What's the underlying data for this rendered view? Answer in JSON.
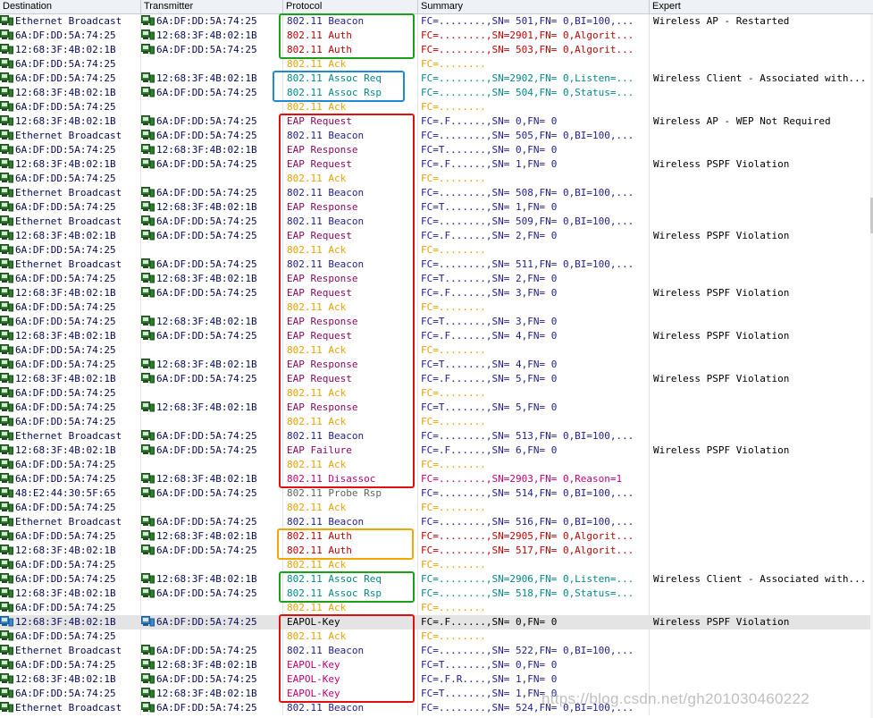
{
  "columns": [
    "Destination",
    "Transmitter",
    "Protocol",
    "Summary",
    "Expert"
  ],
  "colors": {
    "beacon": "#1e1e8c",
    "auth": "#c00000",
    "ack": "#e8a000",
    "assoc": "#008888",
    "eap": "#8a0a60",
    "eapol": "#000000",
    "probe": "#606060",
    "disassoc": "#c0007a",
    "summary_default": "#1e1e8c",
    "box_green": "#1ca01c",
    "box_blue": "#1e8ad6",
    "box_red": "#e01010",
    "box_orange": "#f0a800"
  },
  "rows": [
    {
      "dst": "Ethernet Broadcast",
      "tx": "6A:DF:DD:5A:74:25",
      "proto": "802.11 Beacon",
      "pc": "beacon",
      "sum": "FC=........,SN= 501,FN= 0,BI=100,...",
      "sc": "beacon",
      "exp": "Wireless AP - Restarted"
    },
    {
      "dst": "6A:DF:DD:5A:74:25",
      "tx": "12:68:3F:4B:02:1B",
      "proto": "802.11 Auth",
      "pc": "auth",
      "sum": "FC=........,SN=2901,FN= 0,Algorit...",
      "sc": "auth",
      "exp": ""
    },
    {
      "dst": "12:68:3F:4B:02:1B",
      "tx": "6A:DF:DD:5A:74:25",
      "proto": "802.11 Auth",
      "pc": "auth",
      "sum": "FC=........,SN= 503,FN= 0,Algorit...",
      "sc": "auth",
      "exp": ""
    },
    {
      "dst": "6A:DF:DD:5A:74:25",
      "tx": "",
      "proto": "802.11 Ack",
      "pc": "ack",
      "sum": "FC=........",
      "sc": "ack",
      "exp": ""
    },
    {
      "dst": "6A:DF:DD:5A:74:25",
      "tx": "12:68:3F:4B:02:1B",
      "proto": "802.11 Assoc Req",
      "pc": "assoc",
      "sum": "FC=........,SN=2902,FN= 0,Listen=...",
      "sc": "assoc",
      "exp": "Wireless Client - Associated with..."
    },
    {
      "dst": "12:68:3F:4B:02:1B",
      "tx": "6A:DF:DD:5A:74:25",
      "proto": "802.11 Assoc Rsp",
      "pc": "assoc",
      "sum": "FC=........,SN= 504,FN= 0,Status=...",
      "sc": "assoc",
      "exp": ""
    },
    {
      "dst": "6A:DF:DD:5A:74:25",
      "tx": "",
      "proto": "802.11 Ack",
      "pc": "ack",
      "sum": "FC=........",
      "sc": "ack",
      "exp": ""
    },
    {
      "dst": "12:68:3F:4B:02:1B",
      "tx": "6A:DF:DD:5A:74:25",
      "proto": "EAP Request",
      "pc": "eap",
      "sum": "FC=.F......,SN=   0,FN= 0",
      "sc": "beacon",
      "exp": "Wireless AP - WEP Not Required"
    },
    {
      "dst": "Ethernet Broadcast",
      "tx": "6A:DF:DD:5A:74:25",
      "proto": "802.11 Beacon",
      "pc": "beacon",
      "sum": "FC=........,SN= 505,FN= 0,BI=100,...",
      "sc": "beacon",
      "exp": ""
    },
    {
      "dst": "6A:DF:DD:5A:74:25",
      "tx": "12:68:3F:4B:02:1B",
      "proto": "EAP Response",
      "pc": "eap",
      "sum": "FC=T.......,SN=   0,FN= 0",
      "sc": "beacon",
      "exp": ""
    },
    {
      "dst": "12:68:3F:4B:02:1B",
      "tx": "6A:DF:DD:5A:74:25",
      "proto": "EAP Request",
      "pc": "eap",
      "sum": "FC=.F......,SN=   1,FN= 0",
      "sc": "beacon",
      "exp": "Wireless PSPF Violation"
    },
    {
      "dst": "6A:DF:DD:5A:74:25",
      "tx": "",
      "proto": "802.11 Ack",
      "pc": "ack",
      "sum": "FC=........",
      "sc": "ack",
      "exp": ""
    },
    {
      "dst": "Ethernet Broadcast",
      "tx": "6A:DF:DD:5A:74:25",
      "proto": "802.11 Beacon",
      "pc": "beacon",
      "sum": "FC=........,SN= 508,FN= 0,BI=100,...",
      "sc": "beacon",
      "exp": ""
    },
    {
      "dst": "6A:DF:DD:5A:74:25",
      "tx": "12:68:3F:4B:02:1B",
      "proto": "EAP Response",
      "pc": "eap",
      "sum": "FC=T.......,SN=   1,FN= 0",
      "sc": "beacon",
      "exp": ""
    },
    {
      "dst": "Ethernet Broadcast",
      "tx": "6A:DF:DD:5A:74:25",
      "proto": "802.11 Beacon",
      "pc": "beacon",
      "sum": "FC=........,SN= 509,FN= 0,BI=100,...",
      "sc": "beacon",
      "exp": ""
    },
    {
      "dst": "12:68:3F:4B:02:1B",
      "tx": "6A:DF:DD:5A:74:25",
      "proto": "EAP Request",
      "pc": "eap",
      "sum": "FC=.F......,SN=   2,FN= 0",
      "sc": "beacon",
      "exp": "Wireless PSPF Violation"
    },
    {
      "dst": "6A:DF:DD:5A:74:25",
      "tx": "",
      "proto": "802.11 Ack",
      "pc": "ack",
      "sum": "FC=........",
      "sc": "ack",
      "exp": ""
    },
    {
      "dst": "Ethernet Broadcast",
      "tx": "6A:DF:DD:5A:74:25",
      "proto": "802.11 Beacon",
      "pc": "beacon",
      "sum": "FC=........,SN= 511,FN= 0,BI=100,...",
      "sc": "beacon",
      "exp": ""
    },
    {
      "dst": "6A:DF:DD:5A:74:25",
      "tx": "12:68:3F:4B:02:1B",
      "proto": "EAP Response",
      "pc": "eap",
      "sum": "FC=T.......,SN=   2,FN= 0",
      "sc": "beacon",
      "exp": ""
    },
    {
      "dst": "12:68:3F:4B:02:1B",
      "tx": "6A:DF:DD:5A:74:25",
      "proto": "EAP Request",
      "pc": "eap",
      "sum": "FC=.F......,SN=   3,FN= 0",
      "sc": "beacon",
      "exp": "Wireless PSPF Violation"
    },
    {
      "dst": "6A:DF:DD:5A:74:25",
      "tx": "",
      "proto": "802.11 Ack",
      "pc": "ack",
      "sum": "FC=........",
      "sc": "ack",
      "exp": ""
    },
    {
      "dst": "6A:DF:DD:5A:74:25",
      "tx": "12:68:3F:4B:02:1B",
      "proto": "EAP Response",
      "pc": "eap",
      "sum": "FC=T.......,SN=   3,FN= 0",
      "sc": "beacon",
      "exp": ""
    },
    {
      "dst": "12:68:3F:4B:02:1B",
      "tx": "6A:DF:DD:5A:74:25",
      "proto": "EAP Request",
      "pc": "eap",
      "sum": "FC=.F......,SN=   4,FN= 0",
      "sc": "beacon",
      "exp": "Wireless PSPF Violation"
    },
    {
      "dst": "6A:DF:DD:5A:74:25",
      "tx": "",
      "proto": "802.11 Ack",
      "pc": "ack",
      "sum": "FC=........",
      "sc": "ack",
      "exp": ""
    },
    {
      "dst": "6A:DF:DD:5A:74:25",
      "tx": "12:68:3F:4B:02:1B",
      "proto": "EAP Response",
      "pc": "eap",
      "sum": "FC=T.......,SN=   4,FN= 0",
      "sc": "beacon",
      "exp": ""
    },
    {
      "dst": "12:68:3F:4B:02:1B",
      "tx": "6A:DF:DD:5A:74:25",
      "proto": "EAP Request",
      "pc": "eap",
      "sum": "FC=.F......,SN=   5,FN= 0",
      "sc": "beacon",
      "exp": "Wireless PSPF Violation"
    },
    {
      "dst": "6A:DF:DD:5A:74:25",
      "tx": "",
      "proto": "802.11 Ack",
      "pc": "ack",
      "sum": "FC=........",
      "sc": "ack",
      "exp": ""
    },
    {
      "dst": "6A:DF:DD:5A:74:25",
      "tx": "12:68:3F:4B:02:1B",
      "proto": "EAP Response",
      "pc": "eap",
      "sum": "FC=T.......,SN=   5,FN= 0",
      "sc": "beacon",
      "exp": ""
    },
    {
      "dst": "6A:DF:DD:5A:74:25",
      "tx": "",
      "proto": "802.11 Ack",
      "pc": "ack",
      "sum": "FC=........",
      "sc": "ack",
      "exp": ""
    },
    {
      "dst": "Ethernet Broadcast",
      "tx": "6A:DF:DD:5A:74:25",
      "proto": "802.11 Beacon",
      "pc": "beacon",
      "sum": "FC=........,SN= 513,FN= 0,BI=100,...",
      "sc": "beacon",
      "exp": ""
    },
    {
      "dst": "12:68:3F:4B:02:1B",
      "tx": "6A:DF:DD:5A:74:25",
      "proto": "EAP Failure",
      "pc": "eap",
      "sum": "FC=.F......,SN=   6,FN= 0",
      "sc": "beacon",
      "exp": "Wireless PSPF Violation"
    },
    {
      "dst": "6A:DF:DD:5A:74:25",
      "tx": "",
      "proto": "802.11 Ack",
      "pc": "ack",
      "sum": "FC=........",
      "sc": "ack",
      "exp": ""
    },
    {
      "dst": "6A:DF:DD:5A:74:25",
      "tx": "12:68:3F:4B:02:1B",
      "proto": "802.11 Disassoc",
      "pc": "disassoc",
      "sum": "FC=........,SN=2903,FN= 0,Reason=1",
      "sc": "disassoc",
      "exp": ""
    },
    {
      "dst": "48:E2:44:30:5F:65",
      "tx": "6A:DF:DD:5A:74:25",
      "proto": "802.11 Probe Rsp",
      "pc": "probe",
      "sum": "FC=........,SN= 514,FN= 0,BI=100,...",
      "sc": "beacon",
      "exp": ""
    },
    {
      "dst": "6A:DF:DD:5A:74:25",
      "tx": "",
      "proto": "802.11 Ack",
      "pc": "ack",
      "sum": "FC=........",
      "sc": "ack",
      "exp": ""
    },
    {
      "dst": "Ethernet Broadcast",
      "tx": "6A:DF:DD:5A:74:25",
      "proto": "802.11 Beacon",
      "pc": "beacon",
      "sum": "FC=........,SN= 516,FN= 0,BI=100,...",
      "sc": "beacon",
      "exp": ""
    },
    {
      "dst": "6A:DF:DD:5A:74:25",
      "tx": "12:68:3F:4B:02:1B",
      "proto": "802.11 Auth",
      "pc": "auth",
      "sum": "FC=........,SN=2905,FN= 0,Algorit...",
      "sc": "auth",
      "exp": ""
    },
    {
      "dst": "12:68:3F:4B:02:1B",
      "tx": "6A:DF:DD:5A:74:25",
      "proto": "802.11 Auth",
      "pc": "auth",
      "sum": "FC=........,SN= 517,FN= 0,Algorit...",
      "sc": "auth",
      "exp": ""
    },
    {
      "dst": "6A:DF:DD:5A:74:25",
      "tx": "",
      "proto": "802.11 Ack",
      "pc": "ack",
      "sum": "FC=........",
      "sc": "ack",
      "exp": ""
    },
    {
      "dst": "6A:DF:DD:5A:74:25",
      "tx": "12:68:3F:4B:02:1B",
      "proto": "802.11 Assoc Req",
      "pc": "assoc",
      "sum": "FC=........,SN=2906,FN= 0,Listen=...",
      "sc": "assoc",
      "exp": "Wireless Client - Associated with..."
    },
    {
      "dst": "12:68:3F:4B:02:1B",
      "tx": "6A:DF:DD:5A:74:25",
      "proto": "802.11 Assoc Rsp",
      "pc": "assoc",
      "sum": "FC=........,SN= 518,FN= 0,Status=...",
      "sc": "assoc",
      "exp": ""
    },
    {
      "dst": "6A:DF:DD:5A:74:25",
      "tx": "",
      "proto": "802.11 Ack",
      "pc": "ack",
      "sum": "FC=........",
      "sc": "ack",
      "exp": ""
    },
    {
      "dst": "12:68:3F:4B:02:1B",
      "tx": "6A:DF:DD:5A:74:25",
      "proto": "EAPOL-Key",
      "pc": "eapol",
      "sum": "FC=.F......,SN=   0,FN= 0",
      "sc": "eapol",
      "exp": "Wireless PSPF Violation",
      "selected": true
    },
    {
      "dst": "6A:DF:DD:5A:74:25",
      "tx": "",
      "proto": "802.11 Ack",
      "pc": "ack",
      "sum": "FC=........",
      "sc": "ack",
      "exp": ""
    },
    {
      "dst": "Ethernet Broadcast",
      "tx": "6A:DF:DD:5A:74:25",
      "proto": "802.11 Beacon",
      "pc": "beacon",
      "sum": "FC=........,SN= 522,FN= 0,BI=100,...",
      "sc": "beacon",
      "exp": ""
    },
    {
      "dst": "6A:DF:DD:5A:74:25",
      "tx": "12:68:3F:4B:02:1B",
      "proto": "EAPOL-Key",
      "pc": "disassoc",
      "sum": "FC=T.......,SN=   0,FN= 0",
      "sc": "beacon",
      "exp": ""
    },
    {
      "dst": "12:68:3F:4B:02:1B",
      "tx": "6A:DF:DD:5A:74:25",
      "proto": "EAPOL-Key",
      "pc": "disassoc",
      "sum": "FC=.F.R....,SN=   1,FN= 0",
      "sc": "beacon",
      "exp": ""
    },
    {
      "dst": "6A:DF:DD:5A:74:25",
      "tx": "12:68:3F:4B:02:1B",
      "proto": "EAPOL-Key",
      "pc": "disassoc",
      "sum": "FC=T.......,SN=   1,FN= 0",
      "sc": "beacon",
      "exp": ""
    },
    {
      "dst": "Ethernet Broadcast",
      "tx": "6A:DF:DD:5A:74:25",
      "proto": "802.11 Beacon",
      "pc": "beacon",
      "sum": "FC=........,SN= 524,FN= 0,BI=100,...",
      "sc": "beacon",
      "exp": ""
    }
  ],
  "annotations": [
    {
      "color": "box_green",
      "from": 0,
      "to": 2
    },
    {
      "color": "box_blue",
      "from": 4,
      "to": 5
    },
    {
      "color": "box_red",
      "from": 7,
      "to": 32
    },
    {
      "color": "box_orange",
      "from": 36,
      "to": 37
    },
    {
      "color": "box_green",
      "from": 39,
      "to": 40
    },
    {
      "color": "box_red",
      "from": 42,
      "to": 47
    }
  ],
  "watermark": "https://blog.csdn.net/gh201030460222",
  "icons": {
    "station": "network-station-icon"
  }
}
